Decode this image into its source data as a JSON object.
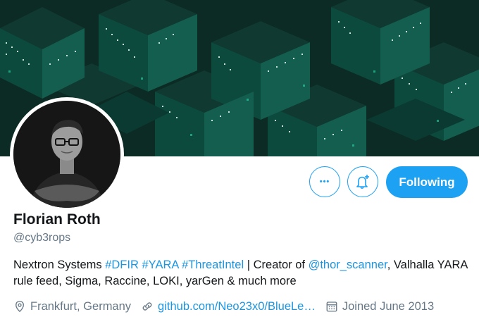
{
  "profile": {
    "name": "Florian Roth",
    "handle": "@cyb3rops"
  },
  "actions": {
    "more_symbol": "•••",
    "following_label": "Following"
  },
  "bio": {
    "company": "Nextron Systems",
    "tag1": "#DFIR",
    "tag2": "#YARA",
    "tag3": "#ThreatIntel",
    "sep": "|",
    "creator_prefix": "Creator of",
    "mention": "@thor_scanner",
    "rest": ", Valhalla YARA rule feed, Sigma, Raccine, LOKI, yarGen & much more"
  },
  "meta": {
    "location": "Frankfurt, Germany",
    "link": "github.com/Neo23x0/BlueLe…",
    "joined": "Joined June 2013"
  },
  "colors": {
    "accent": "#1da1f2",
    "link": "#1b95e0",
    "muted": "#657786",
    "banner": "#0b2b24"
  },
  "icons": {
    "more": "ellipsis-icon",
    "notify": "bell-plus-icon",
    "location": "location-pin-icon",
    "link": "link-icon",
    "calendar": "calendar-icon"
  }
}
